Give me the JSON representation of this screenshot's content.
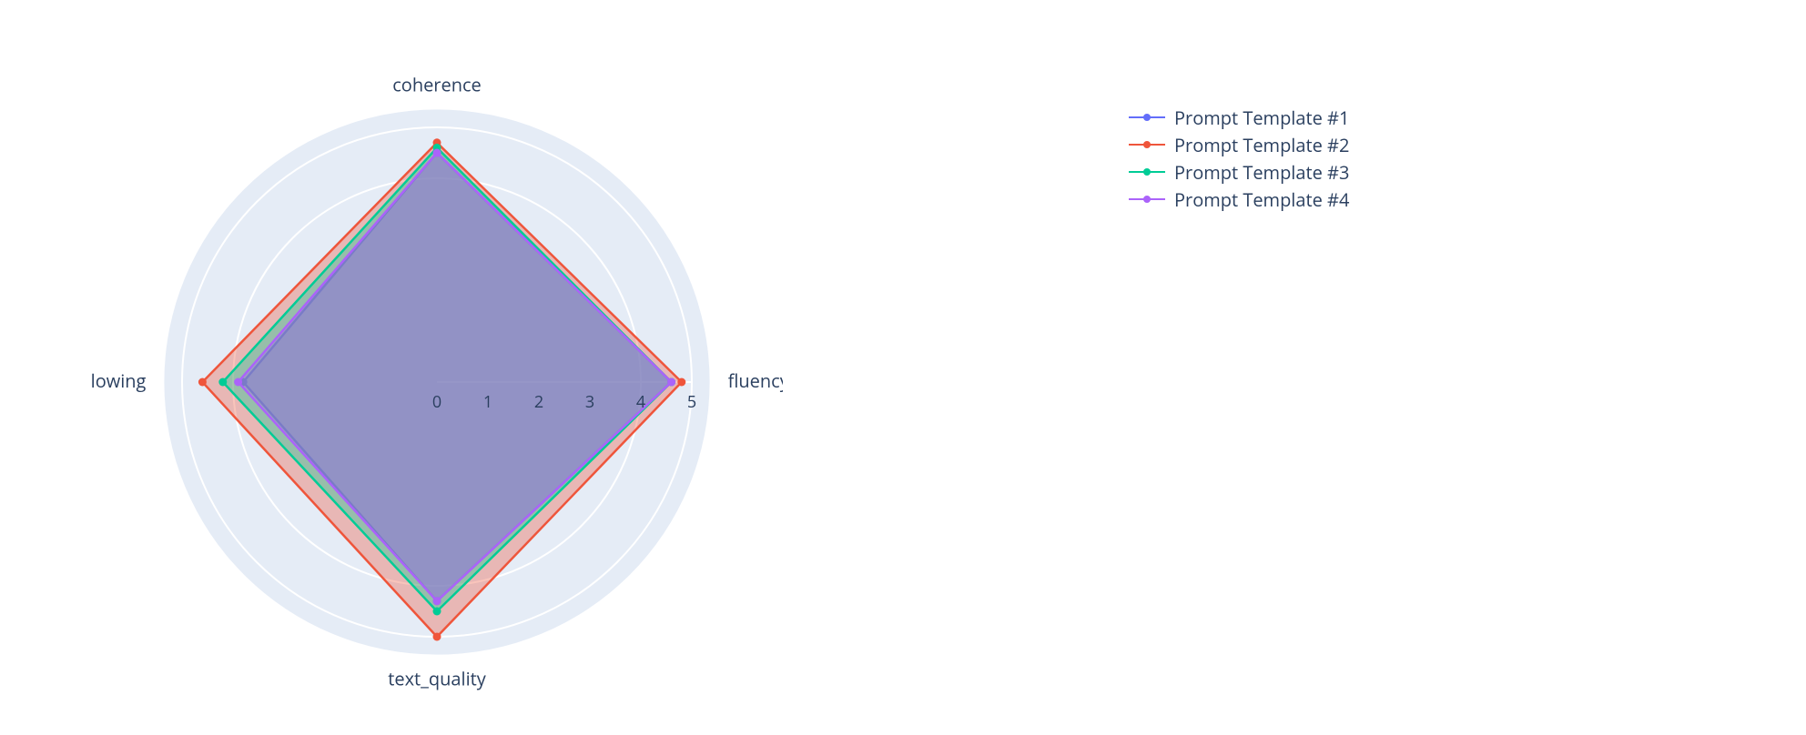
{
  "chart_data": {
    "type": "radar",
    "categories": [
      "fluency",
      "coherence",
      "instruction_following",
      "text_quality"
    ],
    "r_max": 5,
    "ticks": [
      0,
      1,
      2,
      3,
      4,
      5
    ],
    "grid_circles": [
      4,
      5
    ],
    "series": [
      {
        "name": "Prompt Template #1",
        "color": "#636efa",
        "values": [
          4.6,
          4.5,
          3.8,
          4.3
        ]
      },
      {
        "name": "Prompt Template #2",
        "color": "#ef553b",
        "values": [
          4.8,
          4.7,
          4.6,
          5.0
        ]
      },
      {
        "name": "Prompt Template #3",
        "color": "#00cc96",
        "values": [
          4.6,
          4.6,
          4.2,
          4.5
        ]
      },
      {
        "name": "Prompt Template #4",
        "color": "#ab63fa",
        "values": [
          4.6,
          4.5,
          3.9,
          4.3
        ]
      }
    ],
    "background_disc_color": "#e5ecf6",
    "background_visible_rmin": 3.4
  },
  "legend": {
    "items": [
      {
        "label": "Prompt Template #1",
        "color": "#636efa"
      },
      {
        "label": "Prompt Template #2",
        "color": "#ef553b"
      },
      {
        "label": "Prompt Template #3",
        "color": "#00cc96"
      },
      {
        "label": "Prompt Template #4",
        "color": "#ab63fa"
      }
    ]
  }
}
